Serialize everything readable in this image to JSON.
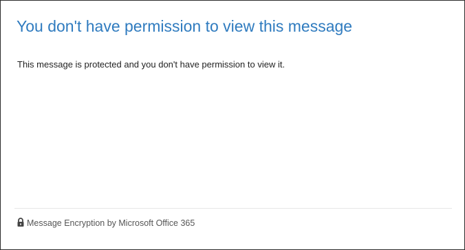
{
  "dialog": {
    "title": "You don't have permission to view this message",
    "message": "This message is protected and you don't have permission to view it."
  },
  "footer": {
    "icon": "lock-icon",
    "text": "Message Encryption by Microsoft Office 365"
  },
  "colors": {
    "title": "#2f7bbf",
    "body_text": "#222222",
    "footer_text": "#555555",
    "border": "#2b2b2b"
  }
}
